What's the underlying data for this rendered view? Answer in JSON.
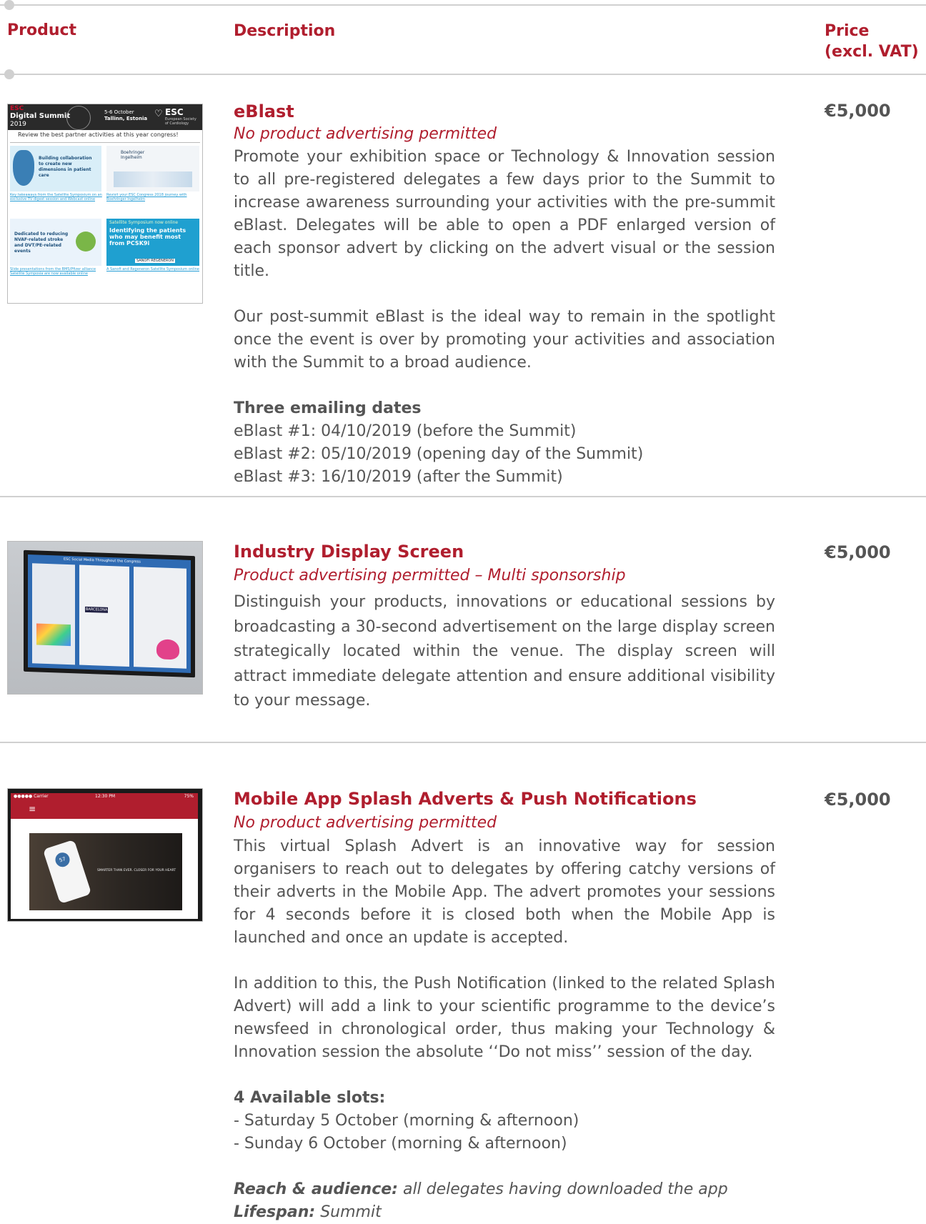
{
  "header": {
    "product_label": "Product",
    "description_label": "Description",
    "price_label_1": "Price",
    "price_label_2": "(excl. VAT)"
  },
  "items": [
    {
      "title": "eBlast",
      "subtitle": "No product advertising permitted",
      "price": "€5,000",
      "paragraph1": "Promote your exhibition space or Technology & Innovation session to all pre-registered delegates a few days prior to the Summit to increase awareness surrounding your activities with the pre-summit eBlast. Delegates will be able to open a PDF enlarged version of each sponsor advert by clicking on the advert visual or the session title.",
      "paragraph2": "Our post-summit eBlast is the ideal way to remain in the spotlight once the event is over by promoting your activities and association with the Summit to a broad audience.",
      "dates_heading": "Three emailing dates",
      "dates": [
        "eBlast #1: 04/10/2019 (before the Summit)",
        "eBlast #2: 05/10/2019 (opening day of the Summit)",
        "eBlast #3: 16/10/2019 (after the Summit)"
      ],
      "thumb": {
        "brand": "ESC",
        "event": "Digital Summit",
        "year": "2019",
        "dates": "5-6 October",
        "city": "Tallinn, Estonia",
        "society": "ESC",
        "society_sub": "European Society of Cardiology",
        "headline": "Review the best partner activities at this year congress!",
        "card1": "Building collaboration to create new dimensions in patient care",
        "card1_link": "Key takeaways from the Satellite Symposium on an exclusive TV digest session and Webcast online",
        "card2": "Boehringer Ingelheim",
        "card2_link": "Revisit your ESC Congress 2018 journey with Boehringer Ingelheim",
        "card3": "Dedicated to reducing NVAF-related stroke and DVT/PE-related events",
        "card3_link": "Slide presentations from the BMS/Pfizer alliance Satellite Symposia are now available online",
        "card4_top": "Satellite Symposium now online",
        "card4_main": "Identifying the patients who may benefit most from PCSK9i",
        "card4_link": "A Sanofi and Regeneron Satellite Symposium online",
        "card4_brands": "SANOFI  REGENERON"
      }
    },
    {
      "title": "Industry Display Screen",
      "subtitle": "Product advertising permitted – Multi sponsorship",
      "price": "€5,000",
      "paragraph1": "Distinguish your products, innovations or educational sessions by broadcasting a 30-second advertisement on the large display screen strategically located within the venue. The display screen will attract immediate delegate attention and ensure additional visibility to your message.",
      "thumb": {
        "screen_title": "ESC Social Media Throughout the Congress",
        "screen_city": "BARCELONA"
      }
    },
    {
      "title": "Mobile App Splash Adverts & Push Notifications",
      "subtitle": "No product advertising permitted",
      "price": "€5,000",
      "paragraph1": "This virtual Splash Advert is an innovative way for session organisers to reach out to delegates by offering catchy versions of their adverts in the Mobile App. The advert promotes your sessions for 4 seconds before it is closed both when the Mobile App is launched and once an update is accepted.",
      "paragraph2": "In addition to this, the Push Notification (linked to the related Splash Advert) will add a link to your scientific programme to the device’s newsfeed in chronological order, thus making your Technology & Innovation session the absolute ‘‘Do not miss’’ session of the day.",
      "slots_heading": "4 Available slots:",
      "slots": [
        "- Saturday 5 October (morning & afternoon)",
        "- Sunday 6 October (morning & afternoon)"
      ],
      "reach_label": "Reach & audience:",
      "reach_value": " all delegates having downloaded the app",
      "lifespan_label": "Lifespan:",
      "lifespan_value": " Summit",
      "thumb": {
        "carrier": "●●●●● Carrier",
        "time": "12:30 PM",
        "battery": "75%",
        "phone_num": "57",
        "tagline": "SMARTER THAN EVER. CLOSER FOR YOUR HEART"
      }
    }
  ]
}
